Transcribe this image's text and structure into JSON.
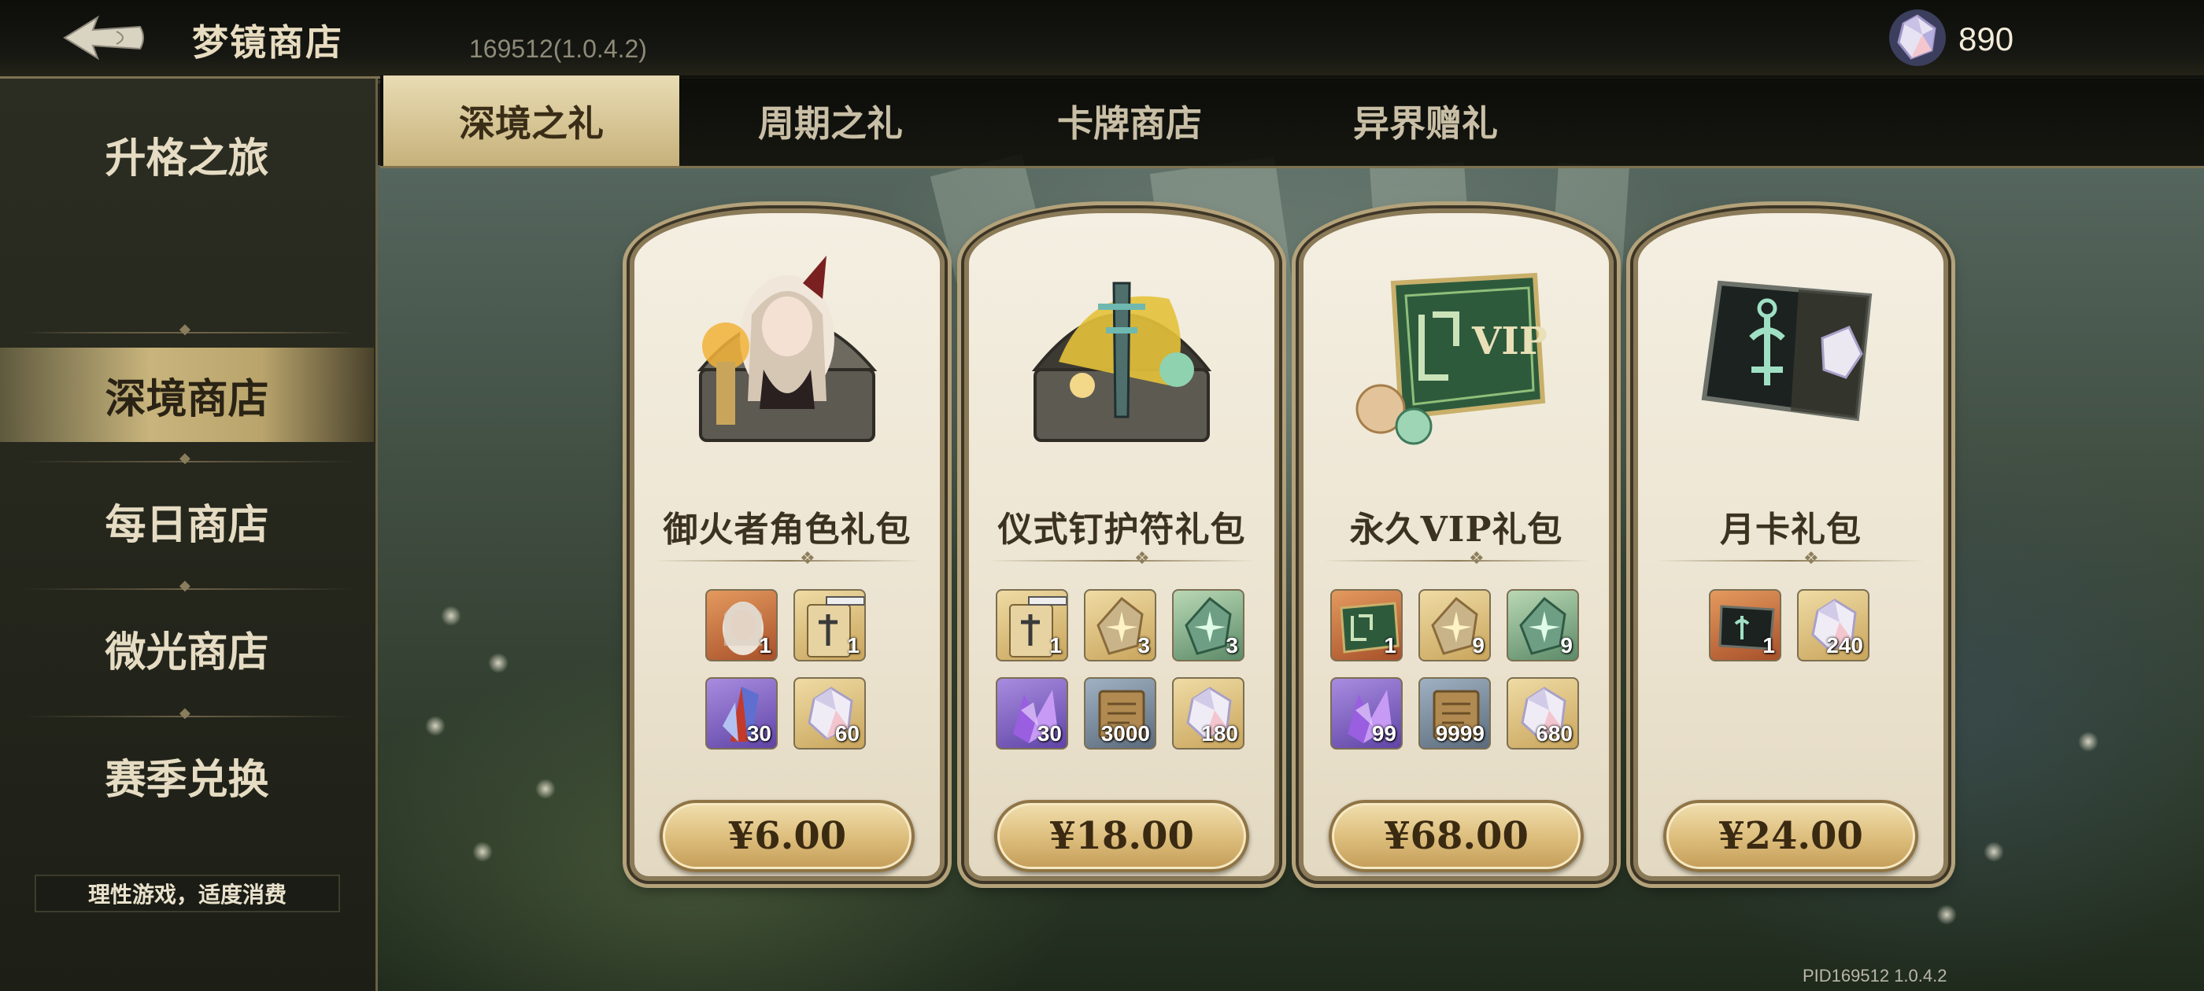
{
  "topbar": {
    "title": "梦镜商店",
    "version": "169512(1.0.4.2)",
    "currency_icon": "crystal-icon",
    "currency_value": "890"
  },
  "sidebar": {
    "items": [
      {
        "label": "升格之旅",
        "active": false
      },
      {
        "label": "深境商店",
        "active": true
      },
      {
        "label": "每日商店",
        "active": false
      },
      {
        "label": "微光商店",
        "active": false
      },
      {
        "label": "赛季兑换",
        "active": false
      }
    ],
    "notice": "理性游戏，适度消费"
  },
  "tabs": [
    {
      "label": "深境之礼",
      "active": true
    },
    {
      "label": "周期之礼",
      "active": false
    },
    {
      "label": "卡牌商店",
      "active": false
    },
    {
      "label": "异界赠礼",
      "active": false
    }
  ],
  "packs": [
    {
      "title": "御火者角色礼包",
      "art": "character-chest",
      "price": "¥6.00",
      "items": [
        {
          "icon": "character-portrait-icon",
          "qty": "1",
          "rarity": "orange"
        },
        {
          "icon": "ritual-nail-scroll-icon",
          "qty": "1",
          "rarity": "gold"
        },
        {
          "icon": "crystal-shard-icon",
          "qty": "30",
          "rarity": "purple"
        },
        {
          "icon": "crystal-icon",
          "qty": "60",
          "rarity": "gold"
        }
      ]
    },
    {
      "title": "仪式钉护符礼包",
      "art": "amulet-chest",
      "price": "¥18.00",
      "items": [
        {
          "icon": "ritual-nail-scroll-icon",
          "qty": "1",
          "rarity": "gold"
        },
        {
          "icon": "gold-rune-stone-icon",
          "qty": "3",
          "rarity": "gold"
        },
        {
          "icon": "green-rune-stone-icon",
          "qty": "3",
          "rarity": "green"
        },
        {
          "icon": "purple-crystal-icon",
          "qty": "30",
          "rarity": "purple"
        },
        {
          "icon": "scroll-icon",
          "qty": "3000",
          "rarity": "grey"
        },
        {
          "icon": "crystal-icon",
          "qty": "180",
          "rarity": "gold"
        }
      ]
    },
    {
      "title": "永久VIP礼包",
      "art": "vip-card",
      "price": "¥68.00",
      "items": [
        {
          "icon": "vip-card-icon",
          "qty": "1",
          "rarity": "orange"
        },
        {
          "icon": "gold-rune-stone-icon",
          "qty": "9",
          "rarity": "gold"
        },
        {
          "icon": "green-rune-stone-icon",
          "qty": "9",
          "rarity": "green"
        },
        {
          "icon": "purple-crystal-icon",
          "qty": "99",
          "rarity": "purple"
        },
        {
          "icon": "scroll-icon",
          "qty": "9999",
          "rarity": "grey"
        },
        {
          "icon": "crystal-icon",
          "qty": "680",
          "rarity": "gold"
        }
      ]
    },
    {
      "title": "月卡礼包",
      "art": "month-card",
      "price": "¥24.00",
      "items": [
        {
          "icon": "month-card-icon",
          "qty": "1",
          "rarity": "orange"
        },
        {
          "icon": "crystal-icon",
          "qty": "240",
          "rarity": "gold"
        }
      ]
    }
  ],
  "footer": {
    "pid": "PID169512  1.0.4.2"
  }
}
